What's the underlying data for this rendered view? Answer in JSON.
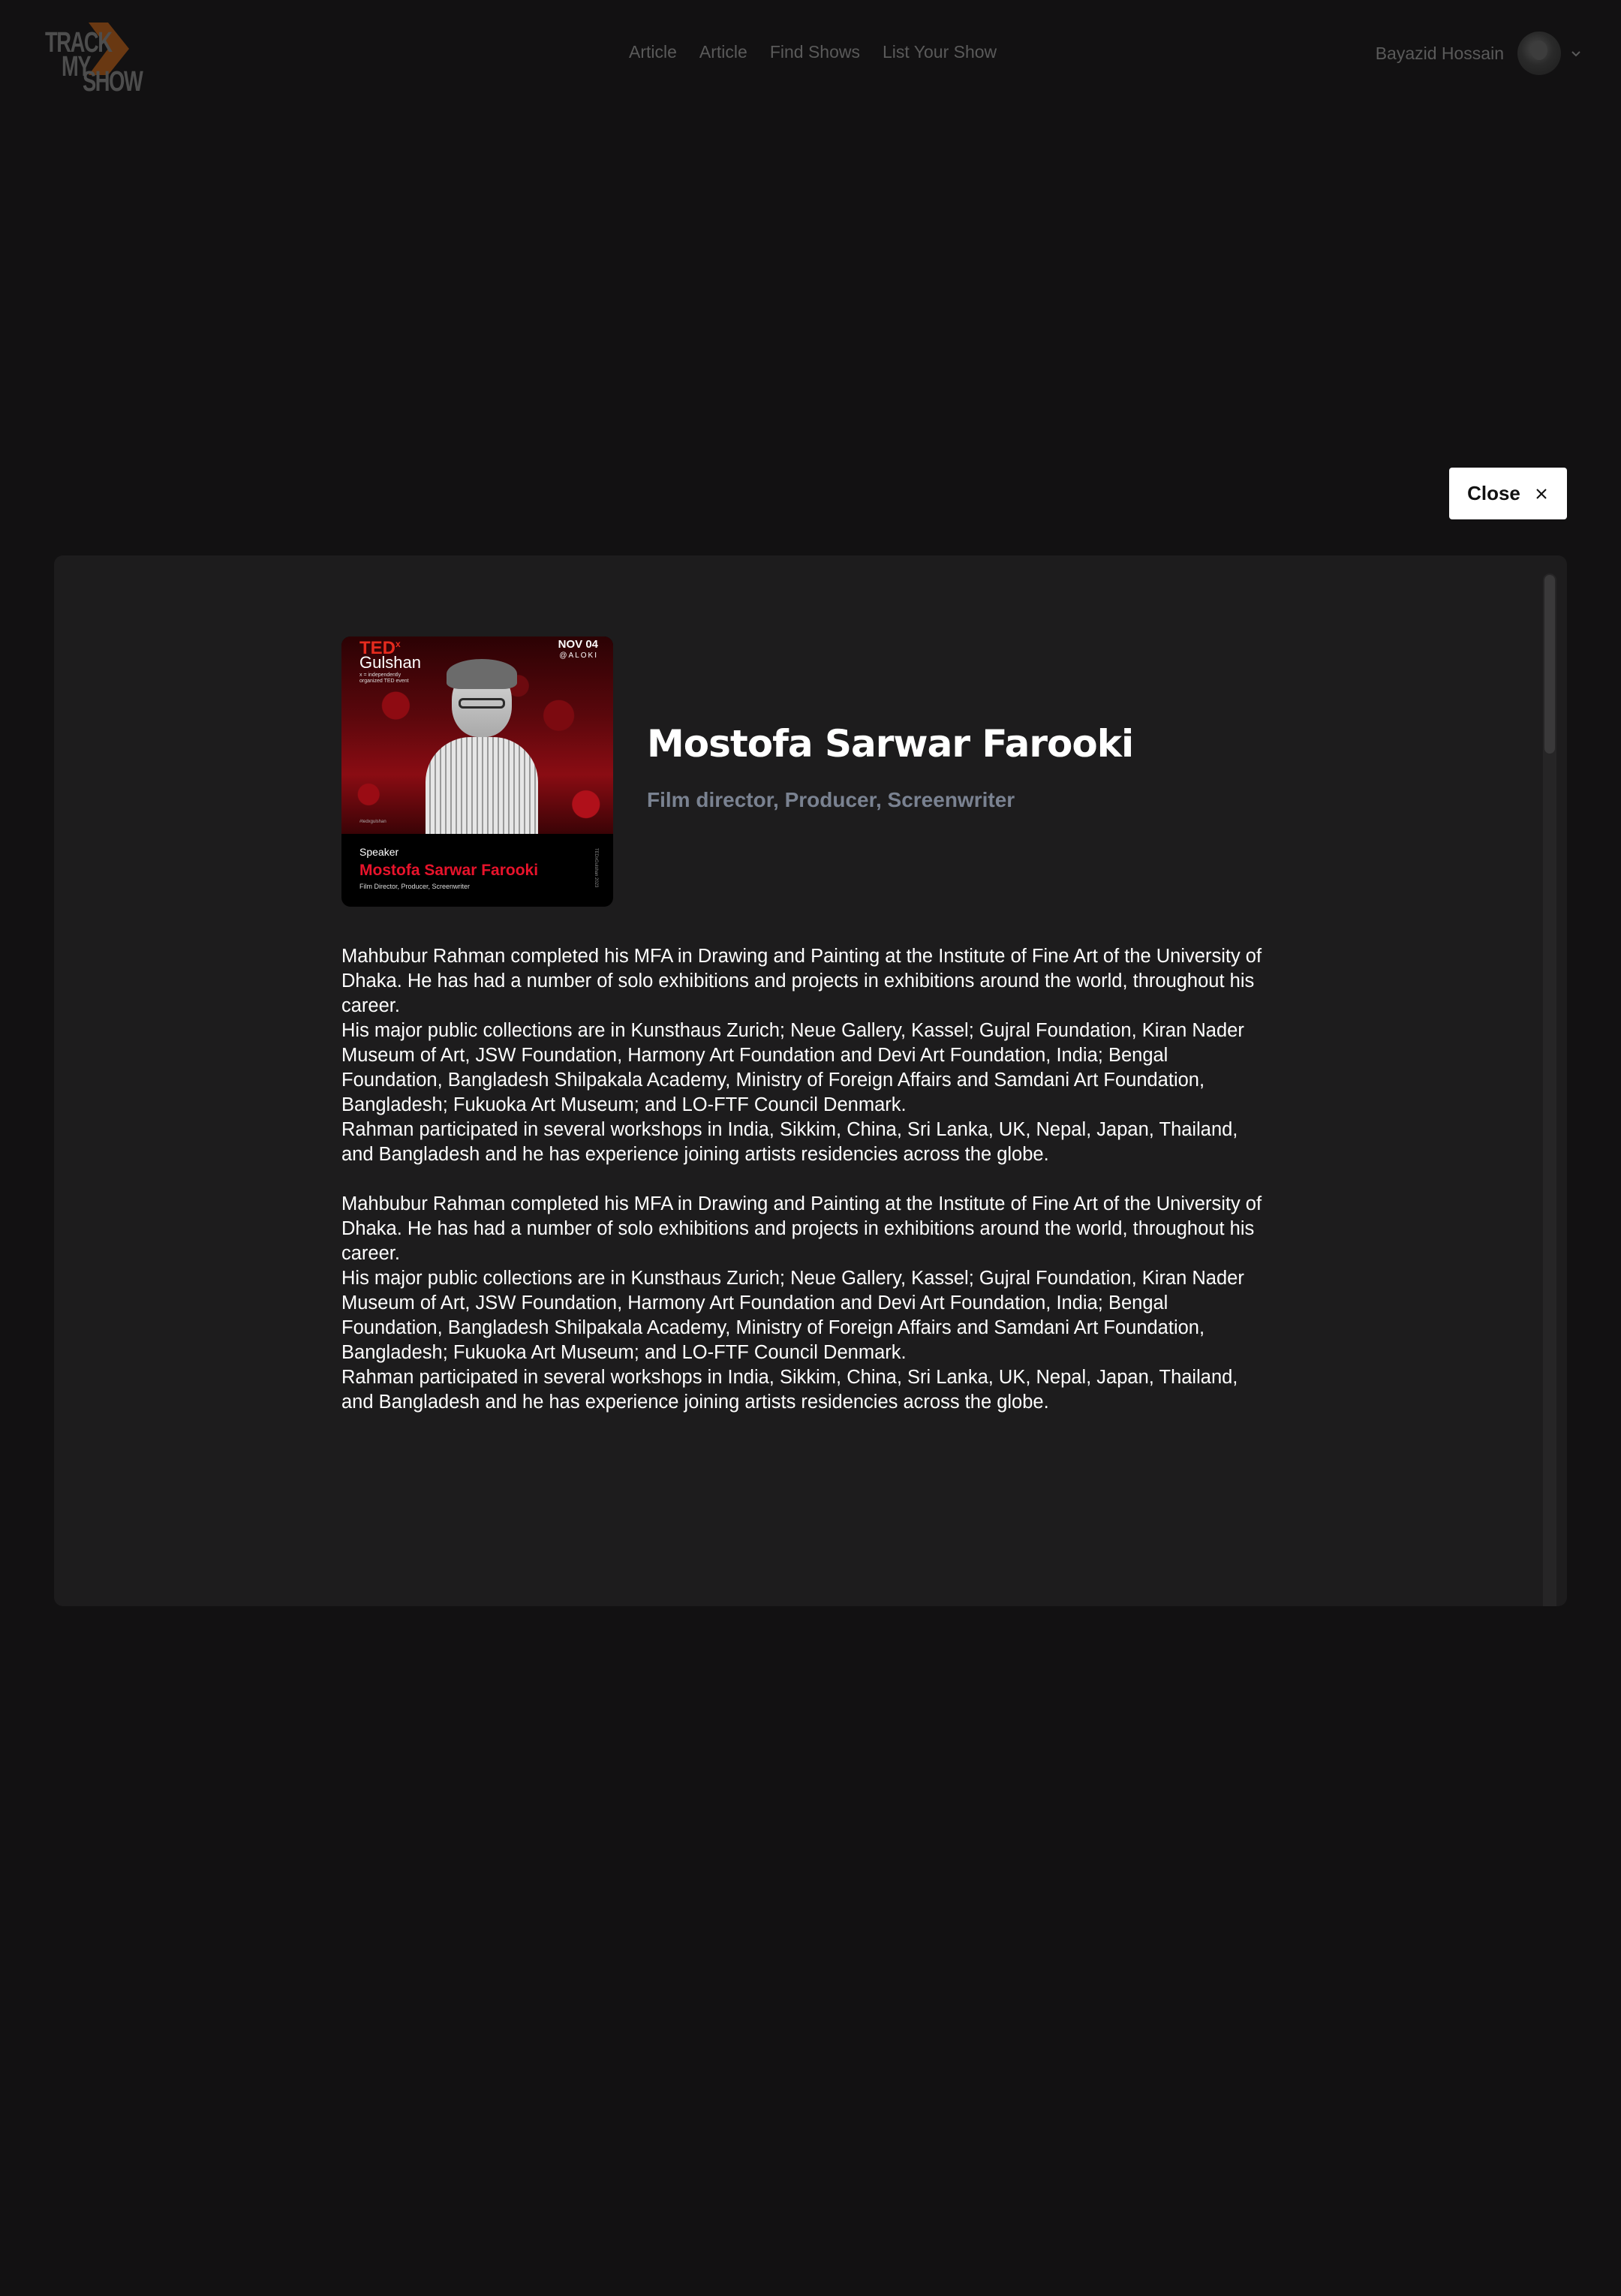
{
  "header": {
    "logo": {
      "line1": "TRACK",
      "line2": "MY",
      "line3": "SHOW",
      "accent_color": "#b05a12"
    },
    "nav": [
      "Article",
      "Article",
      "Find Shows",
      "List Your Show"
    ],
    "user": {
      "name": "Bayazid Hossain",
      "avatar_icon": "avatar",
      "menu_icon": "chevron-down-icon"
    }
  },
  "close_button": {
    "label": "Close",
    "icon": "close-icon"
  },
  "speaker": {
    "name": "Mostofa Sarwar Farooki",
    "roles": "Film director, Producer, Screenwriter",
    "poster": {
      "brand": "TED",
      "brand_mark": "x",
      "event": "Gulshan",
      "tagline": "x = independently organized TED event",
      "date": "NOV 04",
      "venue": "@ALOKI",
      "hashtag": "#tedxgulshan",
      "label": "Speaker",
      "name": "Mostofa Sarwar Farooki",
      "role": "Film Director, Producer, Screenwriter",
      "side_text": "TEDxGulshan 2023"
    },
    "bio": [
      [
        "Mahbubur Rahman completed his MFA in Drawing and Painting at the Institute of Fine Art of the University of Dhaka. He has had a number of solo exhibitions and projects in exhibitions around the world, throughout his career.",
        "His major public collections are in Kunsthaus Zurich; Neue Gallery, Kassel; Gujral Foundation, Kiran Nader Museum of Art, JSW Foundation, Harmony Art Foundation and Devi Art Foundation, India; Bengal Foundation, Bangladesh Shilpakala Academy, Ministry of Foreign Affairs and Samdani Art Foundation, Bangladesh; Fukuoka Art Museum; and LO-FTF Council Denmark.",
        "Rahman participated in several workshops in India, Sikkim, China, Sri Lanka, UK, Nepal, Japan, Thailand, and Bangladesh and he has experience joining artists residencies across the globe."
      ],
      [
        "Mahbubur Rahman completed his MFA in Drawing and Painting at the Institute of Fine Art of the University of Dhaka. He has had a number of solo exhibitions and projects in exhibitions around the world, throughout his career.",
        "His major public collections are in Kunsthaus Zurich; Neue Gallery, Kassel; Gujral Foundation, Kiran Nader Museum of Art, JSW Foundation, Harmony Art Foundation and Devi Art Foundation, India; Bengal Foundation, Bangladesh Shilpakala Academy, Ministry of Foreign Affairs and Samdani Art Foundation, Bangladesh; Fukuoka Art Museum; and LO-FTF Council Denmark.",
        "Rahman participated in several workshops in India, Sikkim, China, Sri Lanka, UK, Nepal, Japan, Thailand, and Bangladesh and he has experience joining artists residencies across the globe."
      ]
    ]
  },
  "colors": {
    "page_bg": "#121112",
    "modal_bg": "#1d1c1d",
    "muted_text": "#5a5a5a",
    "roles_text": "#7a8291",
    "poster_red": "#e8132b"
  }
}
